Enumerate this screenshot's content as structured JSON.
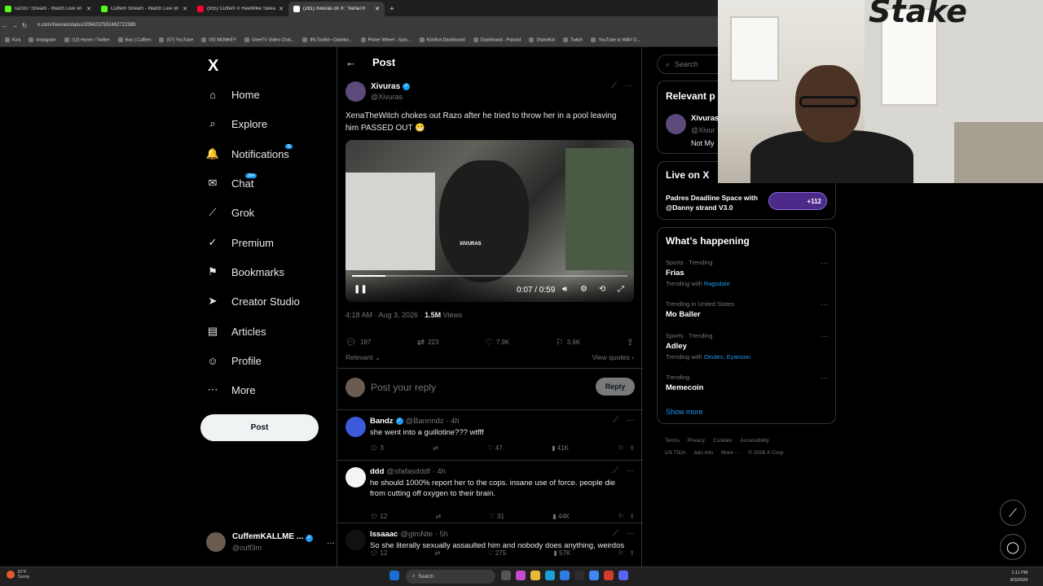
{
  "browser": {
    "tabs": [
      {
        "title": "razo97 Stream - Watch Live on",
        "color": "#53fc18",
        "active": false
      },
      {
        "title": "Cuffem Stream - Watch Live on",
        "color": "#53fc18",
        "active": false
      },
      {
        "title": "(955) Cuffem V HeelMike Swear",
        "color": "#ff0033",
        "active": false
      },
      {
        "title": "(281) Xivuras on X: \"XenaTh",
        "color": "#ffffff",
        "active": true
      }
    ],
    "new_tab": "+",
    "url": "x.com/Xivuras/status/2084237502462722389",
    "bookmarks": [
      "Kick",
      "Instagram",
      "(12) Home / Twitter",
      "Bau | Cuffem",
      "(57) YouTube",
      "OG MONKEY",
      "OmeTV Video Chat...",
      "IRLToolkit • Dashbo...",
      "Picker Wheel - Spin...",
      "KickBot Dashboard",
      "Dashboard - Pulsoid",
      "DistroKid",
      "Twitch",
      "YouTube to WAV D..."
    ]
  },
  "sidebar": {
    "logo": "X",
    "items": [
      {
        "label": "Home",
        "icon": "⌂",
        "badge": ""
      },
      {
        "label": "Explore",
        "icon": "⌕",
        "badge": ""
      },
      {
        "label": "Notifications",
        "icon": "🔔",
        "badge": "5"
      },
      {
        "label": "Chat",
        "icon": "✉",
        "badge": "20+"
      },
      {
        "label": "Grok",
        "icon": "⟋",
        "badge": ""
      },
      {
        "label": "Premium",
        "icon": "✓",
        "badge": ""
      },
      {
        "label": "Bookmarks",
        "icon": "⚑",
        "badge": ""
      },
      {
        "label": "Creator Studio",
        "icon": "➤",
        "badge": ""
      },
      {
        "label": "Articles",
        "icon": "▤",
        "badge": ""
      },
      {
        "label": "Profile",
        "icon": "☺",
        "badge": ""
      },
      {
        "label": "More",
        "icon": "⋯",
        "badge": ""
      }
    ],
    "post_button": "Post",
    "account": {
      "name": "CuffemKALLME ...",
      "handle": "@cuff3m",
      "more": "···"
    }
  },
  "post": {
    "header": "Post",
    "back": "←",
    "author_name": "Xivuras",
    "author_handle": "@Xivuras",
    "text": "XenaTheWitch chokes out Razo after he tried to throw her in a pool leaving him PASSED OUT 😬",
    "video": {
      "time": "0:07 / 0:59",
      "progress": 0.12,
      "watermark": "XIVURAS"
    },
    "meta_time": "4:18 AM · Aug 3, 2026 · ",
    "views_count": "1.5M",
    "views_label": " Views",
    "stats": {
      "replies": "187",
      "reposts": "223",
      "likes": "7.9K",
      "bookmarks": "3.6K"
    },
    "relevant": "Relevant",
    "view_quotes": "View quotes",
    "reply_placeholder": "Post your reply",
    "reply_button": "Reply"
  },
  "comments": [
    {
      "name": "Bandz",
      "handle": "@Bannndz · 4h",
      "text": "she went into a guillotine??? wtfff",
      "replies": "3",
      "likes": "47",
      "views": "41K",
      "avatar_color": "#3b5bdb",
      "verified": true
    },
    {
      "name": "ddd",
      "handle": "@sfafasdddf · 4h",
      "text": "he should 1000% report her to the cops. insane use of force. people die from cutting off oxygen to their brain.",
      "replies": "12",
      "likes": "31",
      "views": "44K",
      "avatar_color": "#f5f5f5",
      "verified": false
    },
    {
      "name": "lssaaac",
      "handle": "@glmNte · 5h",
      "text": "So she literally sexually assaulted him and nobody does anything, weirdos",
      "replies": "12",
      "likes": "275",
      "views": "57K",
      "avatar_color": "#111111",
      "verified": false
    }
  ],
  "right": {
    "search_placeholder": "Search",
    "relevant_title": "Relevant p",
    "relevant_name": "Xivuras",
    "relevant_handle": "@Xivur",
    "relevant_bio": "Not My",
    "live_title": "Live on X",
    "live_space": "Padres Deadline Space with @Danny strand V3.0",
    "live_count": "+112",
    "happening_title": "What’s happening",
    "trends": [
      {
        "cat": "Sports · Trending",
        "title": "Frias",
        "with": "Trending with ",
        "links": "Ragsdale"
      },
      {
        "cat": "Trending in United States",
        "title": "Mo Baller",
        "with": "",
        "links": ""
      },
      {
        "cat": "Sports · Trending",
        "title": "Adley",
        "with": "Trending with ",
        "links": "Orioles, Eyanson"
      },
      {
        "cat": "Trending",
        "title": "Memecoin",
        "with": "",
        "links": ""
      }
    ],
    "show_more": "Show more",
    "footer": [
      "Terms",
      "Privacy",
      "Cookies",
      "Accessibility",
      "US TIDA",
      "Ads info",
      "More ···",
      "© 2026 X Corp."
    ]
  },
  "webcam": {
    "logo": "Stake"
  },
  "taskbar": {
    "temp": "81°F",
    "weather": "Sunny",
    "search": "Search",
    "time": "1:11 PM",
    "date": "8/3/2026"
  }
}
